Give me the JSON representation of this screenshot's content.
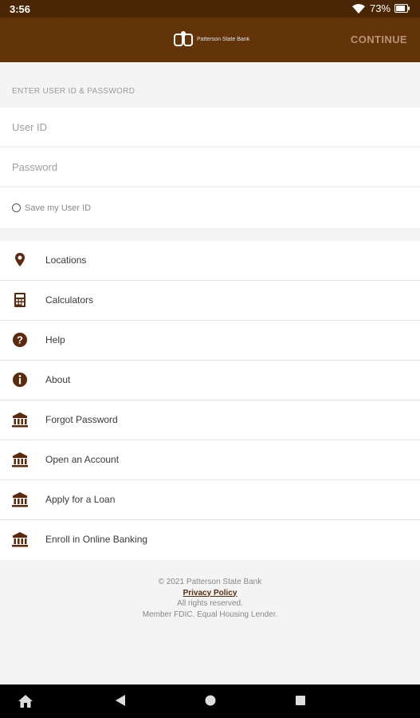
{
  "status_bar": {
    "time": "3:56",
    "battery": "73%",
    "icons": [
      "wifi-icon",
      "battery-icon"
    ]
  },
  "app_bar": {
    "logo_text": "Patterson State Bank",
    "continue_label": "CONTINUE"
  },
  "login": {
    "section_header": "ENTER USER ID & PASSWORD",
    "user_id_placeholder": "User ID",
    "user_id_value": "",
    "password_placeholder": "Password",
    "password_value": "",
    "save_user_id_label": "Save my User ID",
    "save_user_id_checked": false
  },
  "menu": {
    "items": [
      {
        "label": "Locations",
        "icon": "location-pin-icon"
      },
      {
        "label": "Calculators",
        "icon": "calculator-icon"
      },
      {
        "label": "Help",
        "icon": "help-icon"
      },
      {
        "label": "About",
        "icon": "info-icon"
      },
      {
        "label": "Forgot Password",
        "icon": "bank-icon"
      },
      {
        "label": "Open an Account",
        "icon": "bank-icon"
      },
      {
        "label": "Apply for a Loan",
        "icon": "bank-icon"
      },
      {
        "label": "Enroll in Online Banking",
        "icon": "bank-icon"
      }
    ]
  },
  "footer": {
    "copyright": "© 2021 Patterson State Bank",
    "privacy_policy": "Privacy Policy",
    "rights": "All rights reserved.",
    "member": "Member FDIC. Equal Housing Lender."
  },
  "nav_bar": {
    "icons": [
      "home-icon",
      "back-icon",
      "home-circle-icon",
      "recents-icon"
    ]
  },
  "colors": {
    "app_bar": "#633408",
    "status_bar": "#4a2604",
    "icon_brown": "#5c2a0a",
    "continue_text": "#b69577"
  }
}
